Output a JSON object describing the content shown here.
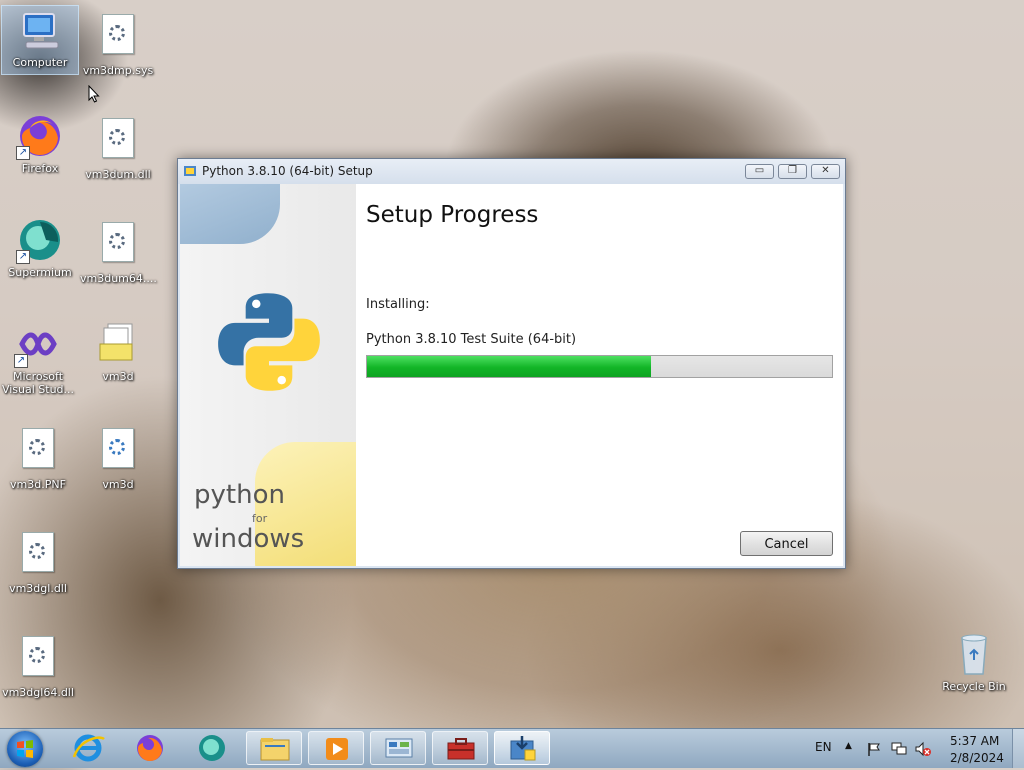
{
  "desktop": {
    "icons": [
      {
        "label": "Computer"
      },
      {
        "label": "vm3dmp.sys"
      },
      {
        "label": "Firefox"
      },
      {
        "label": "vm3dum.dll"
      },
      {
        "label": "Supermium"
      },
      {
        "label": "vm3dum64...."
      },
      {
        "label_line1": "Microsoft",
        "label_line2": "Visual Stud..."
      },
      {
        "label": "vm3d"
      },
      {
        "label": "vm3d.PNF"
      },
      {
        "label": "vm3d"
      },
      {
        "label": "vm3dgl.dll"
      },
      {
        "label": "vm3dgl64.dll"
      },
      {
        "label": "Recycle Bin"
      }
    ]
  },
  "dialog": {
    "title": "Python 3.8.10 (64-bit) Setup",
    "heading": "Setup Progress",
    "installing_label": "Installing:",
    "component": "Python 3.8.10 Test Suite (64-bit)",
    "progress_fraction": 0.61,
    "cancel_label": "Cancel",
    "brand_python": "python",
    "brand_for": "for",
    "brand_windows": "windows",
    "minimize_glyph": "▭",
    "restore_glyph": "❐",
    "close_glyph": "✕"
  },
  "taskbar": {
    "pinned_icons": [
      "windows-start-icon",
      "internet-explorer-icon",
      "firefox-icon",
      "supermium-icon",
      "file-explorer-icon",
      "media-player-icon",
      "control-panel-icon",
      "toolbox-icon",
      "python-setup-icon"
    ],
    "language": "EN",
    "tray_chevron": "▲",
    "time": "5:37 AM",
    "date": "2/8/2024"
  },
  "colors": {
    "progress_green": "#12b527",
    "python_blue": "#3572a5",
    "python_yellow": "#ffd43b"
  }
}
